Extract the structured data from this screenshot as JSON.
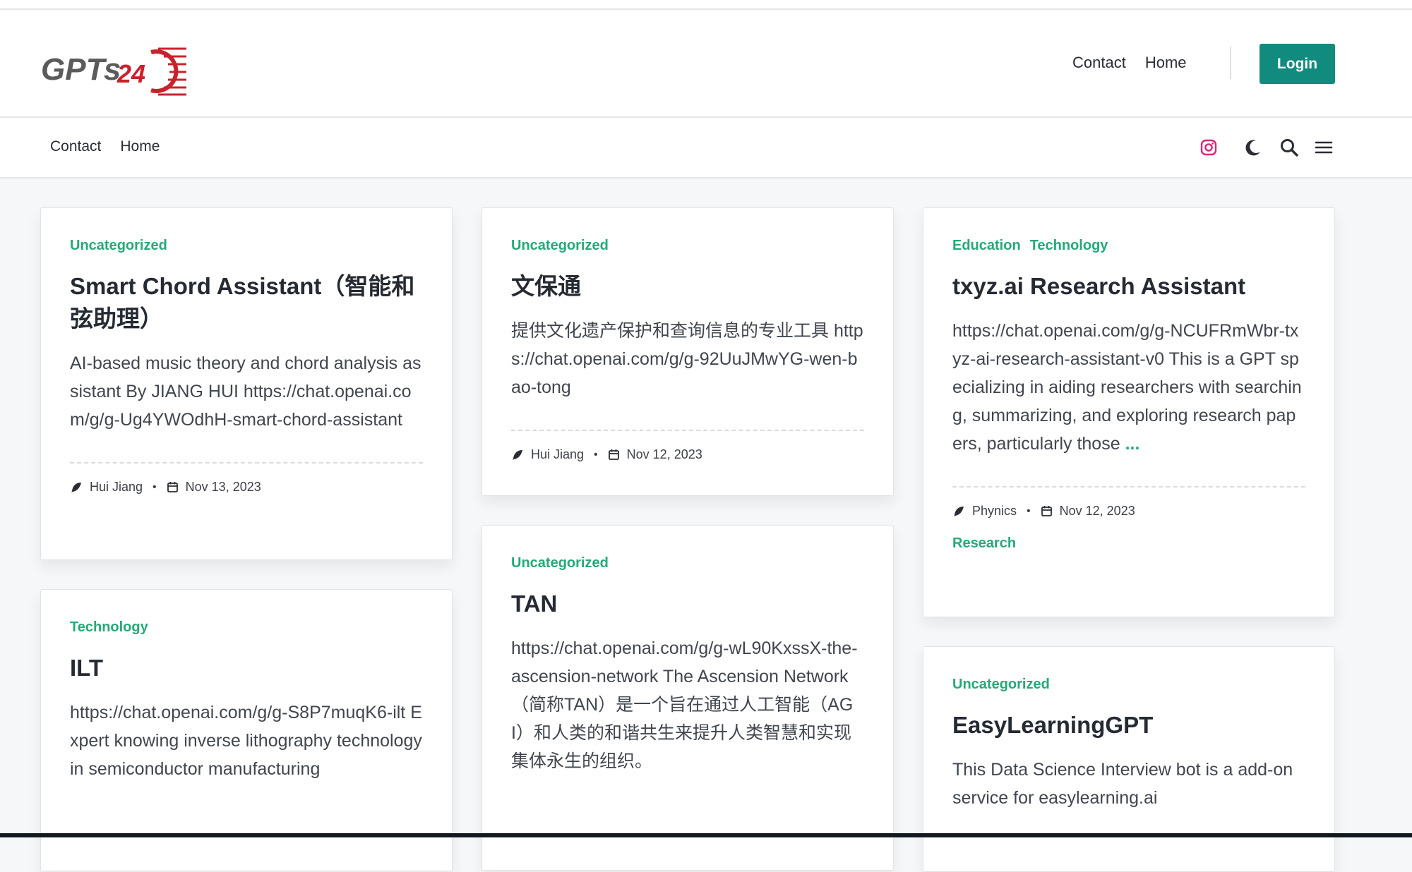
{
  "logo": {
    "text": "GPTs",
    "number": "24",
    "brand_color": "#c8232c"
  },
  "header": {
    "nav": [
      {
        "label": "Contact"
      },
      {
        "label": "Home"
      }
    ],
    "login_label": "Login"
  },
  "subnav": {
    "links": [
      {
        "label": "Contact"
      },
      {
        "label": "Home"
      }
    ],
    "icons": [
      "instagram-icon",
      "moon-icon",
      "search-icon",
      "menu-icon"
    ]
  },
  "colors": {
    "accent": "#25a977",
    "button": "#128b7f",
    "instagram": "#d62976"
  },
  "cards": [
    {
      "categories": [
        "Uncategorized"
      ],
      "title": "Smart Chord Assistant（智能和弦助理）",
      "excerpt": "AI-based music theory and chord analysis assistant By JIANG HUI https://chat.openai.com/g/g-Ug4YWOdhH-smart-chord-assistant",
      "author": "Hui Jiang",
      "date": "Nov 13, 2023"
    },
    {
      "categories": [
        "Uncategorized"
      ],
      "title": "文保通",
      "excerpt": "提供文化遗产保护和查询信息的专业工具 https://chat.openai.com/g/g-92UuJMwYG-wen-bao-tong",
      "author": "Hui Jiang",
      "date": "Nov 12, 2023"
    },
    {
      "categories": [
        "Education",
        "Technology"
      ],
      "title": "txyz.ai Research Assistant",
      "excerpt": "https://chat.openai.com/g/g-NCUFRmWbr-txyz-ai-research-assistant-v0 This is a GPT specializing in aiding researchers with searching, summarizing, and exploring research papers, particularly those",
      "more": "...",
      "author": "Phynics",
      "date": "Nov 12, 2023",
      "tag": "Research"
    },
    {
      "categories": [
        "Technology"
      ],
      "title": "ILT",
      "excerpt": "https://chat.openai.com/g/g-S8P7muqK6-ilt Expert knowing inverse lithography technology in semiconductor manufacturing"
    },
    {
      "categories": [
        "Uncategorized"
      ],
      "title": "TAN",
      "excerpt": "https://chat.openai.com/g/g-wL90KxssX-the-ascension-network The Ascension Network（简称TAN）是一个旨在通过人工智能（AGI）和人类的和谐共生来提升人类智慧和实现集体永生的组织。"
    },
    {
      "categories": [
        "Uncategorized"
      ],
      "title": "EasyLearningGPT",
      "excerpt": "This Data Science Interview bot is a add-on service for easylearning.ai"
    }
  ]
}
